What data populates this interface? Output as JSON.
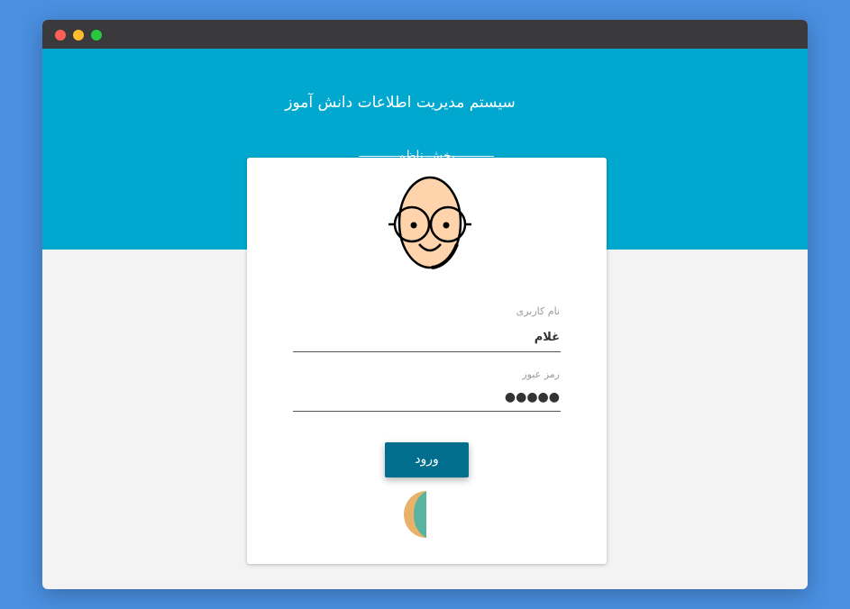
{
  "header": {
    "app_title": "سیستم مدیریت اطلاعات دانش آموز",
    "section_label": "بخش ناظم"
  },
  "login": {
    "avatar_icon": "user-avatar-icon",
    "username": {
      "label": "نام کاربری",
      "value": "غلام"
    },
    "password": {
      "label": "رمز عبور",
      "value": "●●●●●"
    },
    "submit_label": "ورود",
    "loading_icon": "spinner-icon"
  },
  "colors": {
    "header_bg": "#00a8cf",
    "button_bg": "#006e8c",
    "page_bg": "#f3f3f3"
  }
}
